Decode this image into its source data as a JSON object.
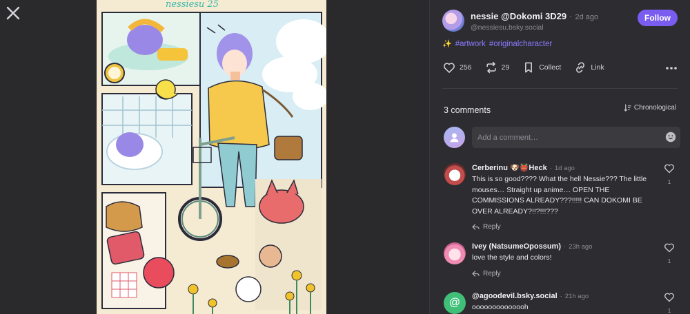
{
  "post": {
    "author_name": "nessie @Dokomi 3D29",
    "time": "2d ago",
    "handle": "@nessiesu.bsky.social",
    "follow_label": "Follow",
    "tag_emoji": "✨",
    "tags": [
      "#artwork",
      "#originalcharacter"
    ],
    "artwork_signature": "nessiesu 25"
  },
  "actions": {
    "likes": "256",
    "reposts": "29",
    "collect_label": "Collect",
    "link_label": "Link"
  },
  "comments_section": {
    "count_label": "3 comments",
    "sort_label": "Chronological",
    "composer_placeholder": "Add a comment…"
  },
  "comments": [
    {
      "name": "Cerberinu 🐶👹Heck",
      "time": "1d ago",
      "text": "This is so good???? What the hell Nessie??? The little mouses… Straight up anime… OPEN THE COMMISSIONS ALREADY???!!!!! CAN DOKOMI BE OVER ALREADY?!!?!!!???",
      "likes": "1",
      "reply_label": "Reply"
    },
    {
      "name": "Ivey (NatsumeOpossum)",
      "time": "23h ago",
      "text": "love the style and colors!",
      "likes": "1",
      "reply_label": "Reply"
    },
    {
      "name": "@agoodevil.bsky.social",
      "time": "21h ago",
      "text": "oooooooooooooh",
      "likes": "1"
    }
  ],
  "colors": {
    "accent": "#7b5cf0",
    "tag": "#8c79ff",
    "panel_bg": "#2d2d31",
    "viewer_bg": "#2a2a2c"
  },
  "icons": {
    "close": "close-icon",
    "like": "heart-icon",
    "repost": "repost-icon",
    "collect": "bookmark-icon",
    "link": "link-icon",
    "more": "more-dots-icon",
    "sort": "sort-icon",
    "emoji": "emoji-icon",
    "reply": "reply-arrow-icon"
  }
}
